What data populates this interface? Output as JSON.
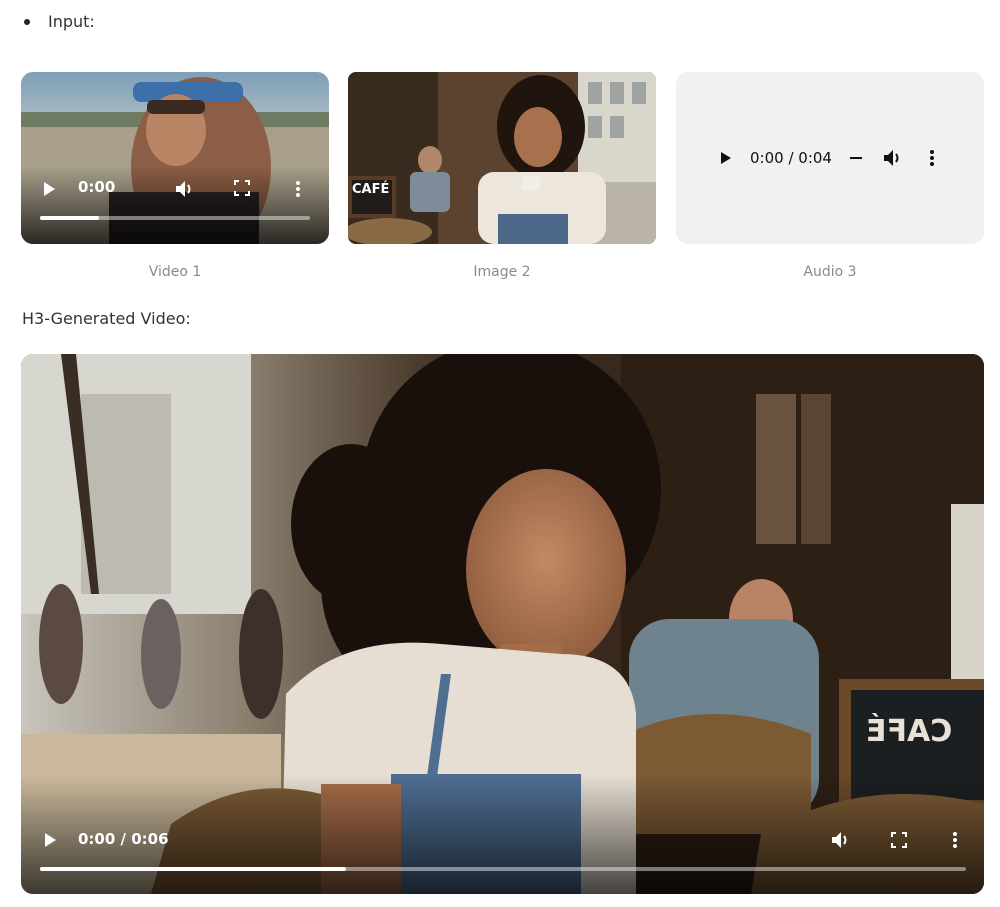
{
  "input_section": {
    "label": "Input:"
  },
  "media": [
    {
      "caption": "Video 1",
      "kind": "video",
      "time": "0:00",
      "progress": 0.22
    },
    {
      "caption": "Image 2",
      "kind": "image",
      "sign_text": "CAFÉ"
    },
    {
      "caption": "Audio 3",
      "kind": "audio",
      "time": "0:00 / 0:04"
    }
  ],
  "generated_section": {
    "label": "H3-Generated Video:"
  },
  "generated_video": {
    "time": "0:00 / 0:06",
    "progress": 0.33,
    "sign_text": "CAFÉ"
  },
  "icons": {
    "play": "play-icon",
    "volume": "volume-icon",
    "fullscreen": "fullscreen-icon",
    "more": "more-vert-icon"
  },
  "colors": {
    "text": "#333333",
    "caption": "#8a8a8a",
    "audio_bg": "#f0f1f3"
  }
}
